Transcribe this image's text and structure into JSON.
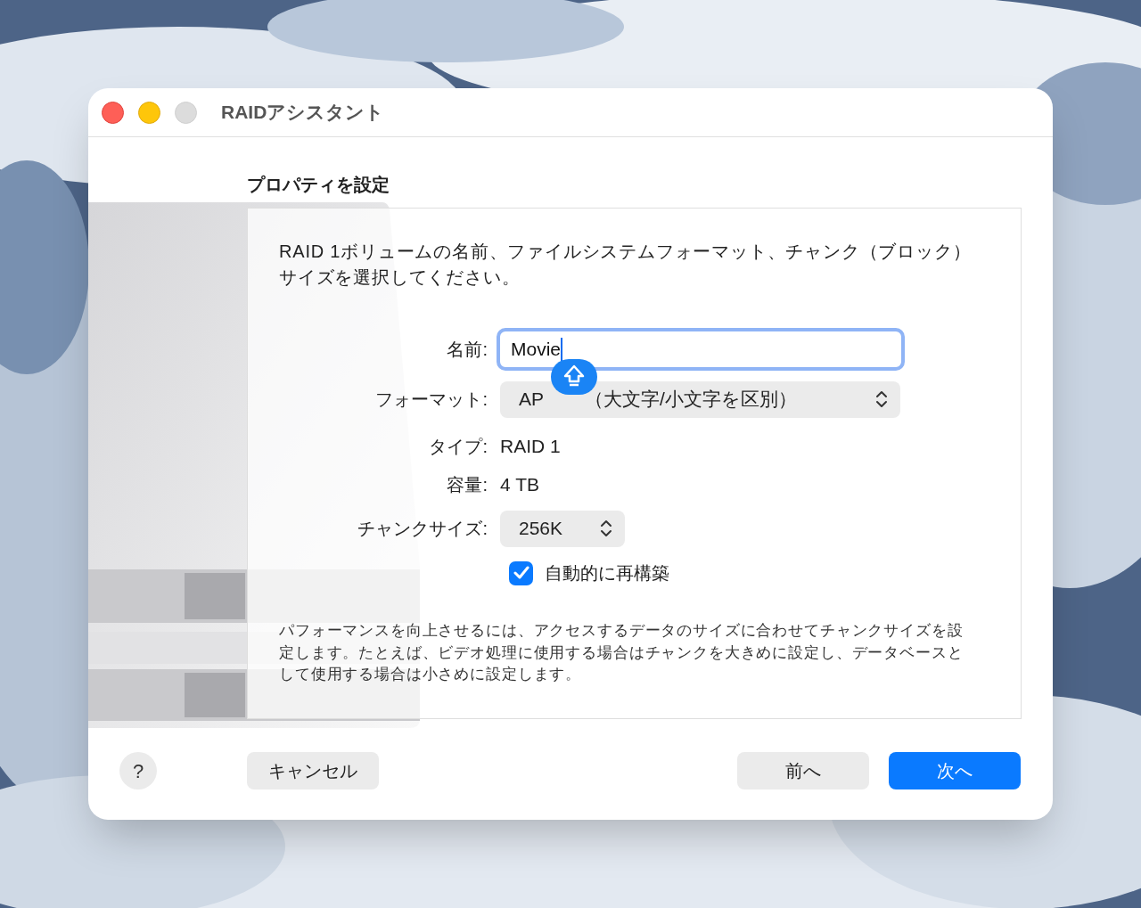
{
  "window": {
    "title": "RAIDアシスタント"
  },
  "heading": "プロパティを設定",
  "description": "RAID 1ボリュームの名前、ファイルシステムフォーマット、チャンク（ブロック）サイズを選択してください。",
  "name_field": {
    "label": "名前:",
    "value": "Movie",
    "focused": true
  },
  "format": {
    "label": "フォーマット:",
    "value_parts": [
      "AP",
      "（大文字/小文字を区別）"
    ]
  },
  "caps_lock": {
    "on": true
  },
  "type": {
    "label": "タイプ:",
    "value": "RAID 1"
  },
  "capacity": {
    "label": "容量:",
    "value": "4 TB"
  },
  "chunk_size": {
    "label": "チャンクサイズ:",
    "value": "256K"
  },
  "rebuild": {
    "label": "自動的に再構築",
    "checked": true
  },
  "note": "パフォーマンスを向上させるには、アクセスするデータのサイズに合わせてチャンクサイズを設定します。たとえば、ビデオ処理に使用する場合はチャンクを大きめに設定し、データベースとして使用する場合は小さめに設定します。",
  "buttons": {
    "help": "?",
    "cancel": "キャンセル",
    "back": "前へ",
    "next": "次へ"
  }
}
